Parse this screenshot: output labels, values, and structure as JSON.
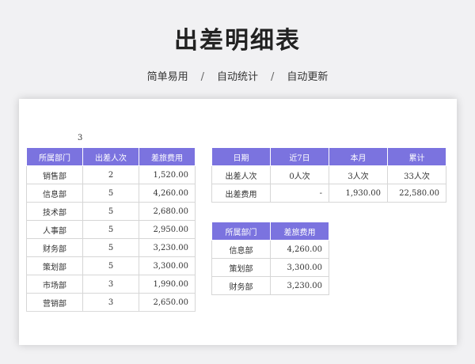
{
  "title": "出差明细表",
  "subnav": [
    "简单易用",
    "自动统计",
    "自动更新"
  ],
  "separator": "/",
  "sheet": {
    "cell_note": "3",
    "dept_table": {
      "headers": [
        "所属部门",
        "出差人次",
        "差旅费用"
      ],
      "rows": [
        [
          "销售部",
          "2",
          "1,520.00"
        ],
        [
          "信息部",
          "5",
          "4,260.00"
        ],
        [
          "技术部",
          "5",
          "2,680.00"
        ],
        [
          "人事部",
          "5",
          "2,950.00"
        ],
        [
          "财务部",
          "5",
          "3,230.00"
        ],
        [
          "策划部",
          "5",
          "3,300.00"
        ],
        [
          "市场部",
          "3",
          "1,990.00"
        ],
        [
          "营销部",
          "3",
          "2,650.00"
        ]
      ]
    },
    "summary_table": {
      "headers": [
        "日期",
        "近7日",
        "本月",
        "累计"
      ],
      "rows": [
        [
          "出差人次",
          "0人次",
          "3人次",
          "33人次"
        ],
        [
          "出差费用",
          "-",
          "1,930.00",
          "22,580.00"
        ]
      ]
    },
    "top_table": {
      "headers": [
        "所属部门",
        "差旅费用"
      ],
      "rows": [
        [
          "信息部",
          "4,260.00"
        ],
        [
          "策划部",
          "3,300.00"
        ],
        [
          "财务部",
          "3,230.00"
        ]
      ]
    }
  },
  "colors": {
    "header_bg": "#7b73df",
    "page_bg": "#f1f1f3"
  }
}
